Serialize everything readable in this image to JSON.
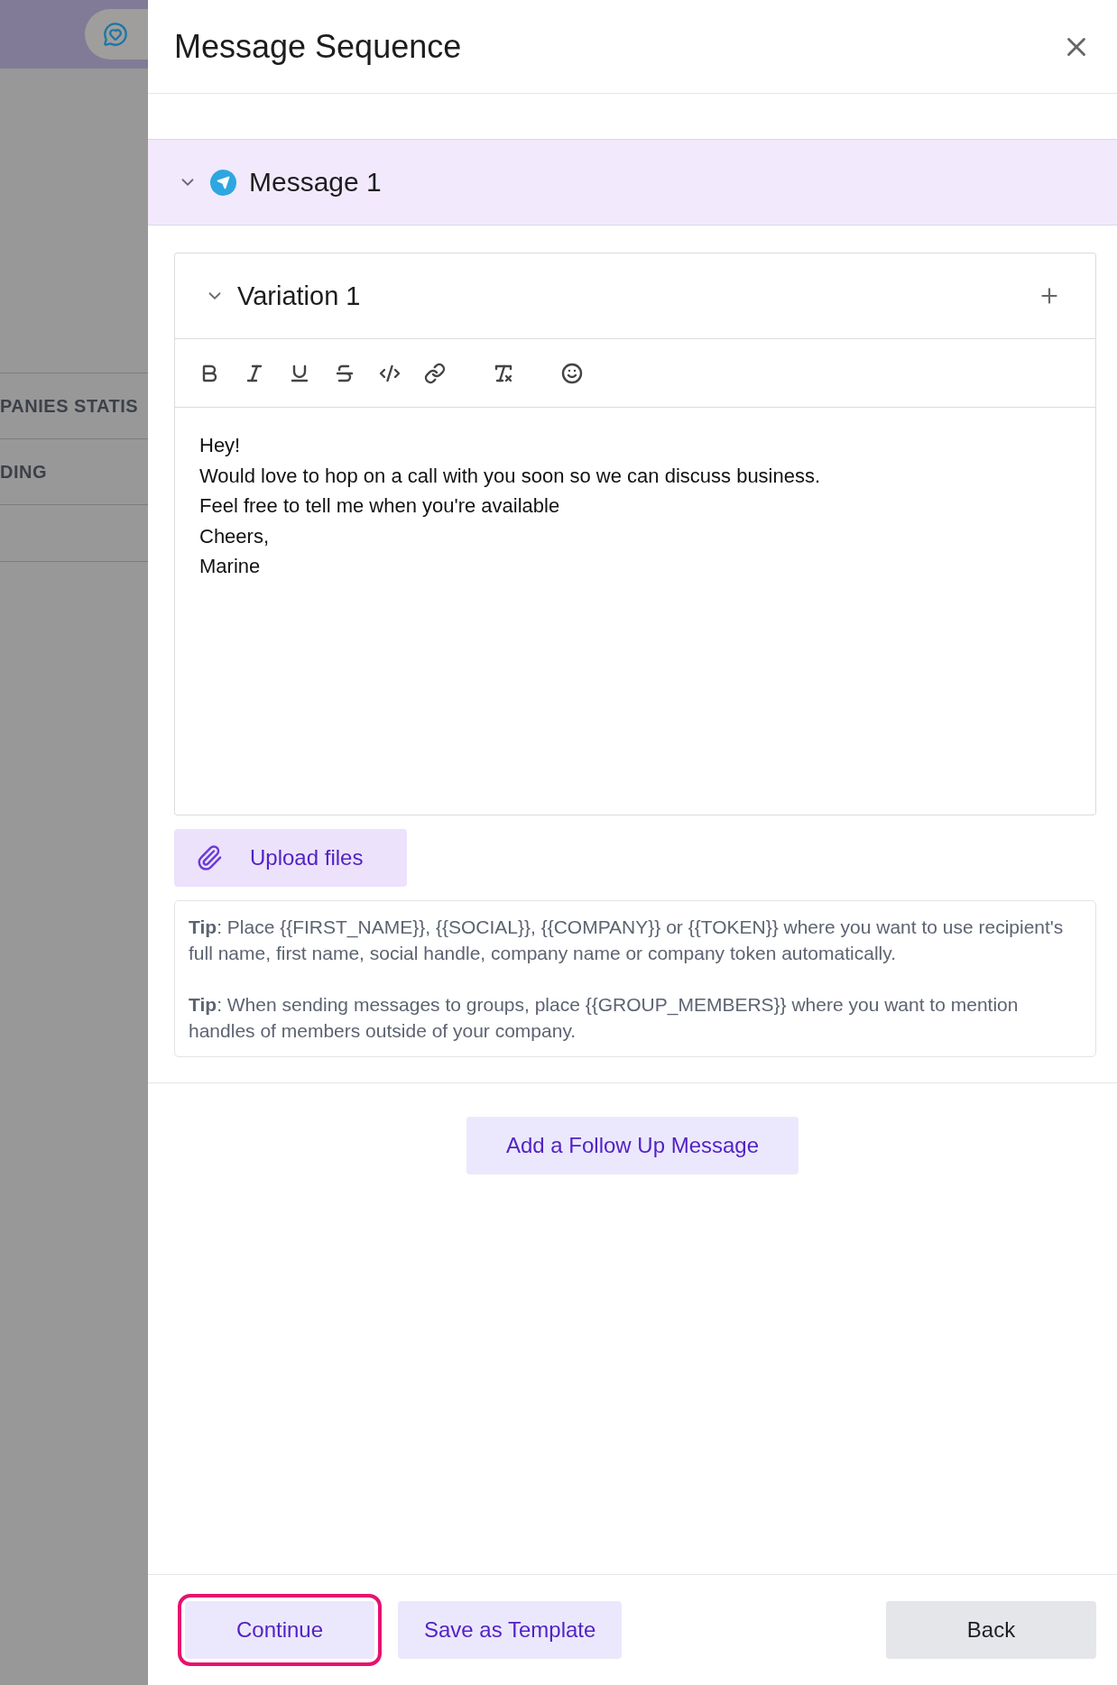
{
  "background": {
    "items": [
      {
        "label": "PANIES STATIS"
      },
      {
        "label": "DING"
      }
    ]
  },
  "dialog": {
    "title": "Message Sequence"
  },
  "messages": [
    {
      "title": "Message 1",
      "expanded": true,
      "variations": [
        {
          "title": "Variation 1",
          "expanded": true,
          "body": "Hey!\nWould love to hop on a call with you soon so we can discuss business.\nFeel free to tell me when you're available\nCheers,\nMarine"
        }
      ]
    }
  ],
  "upload_button": "Upload files",
  "tips": [
    "**Tip**: Place {{FIRST_NAME}}, {{SOCIAL}}, {{COMPANY}} or {{TOKEN}} where you want to use recipient's full name, first name, social handle, company name or company token automatically.",
    "**Tip**: When sending messages to groups, place {{GROUP_MEMBERS}} where you want to mention handles of members outside of your company."
  ],
  "follow_up_button": "Add a Follow Up Message",
  "footer": {
    "buttons": [
      {
        "label": "Continue",
        "kind": "primary",
        "highlighted": true
      },
      {
        "label": "Save as Template",
        "kind": "primary",
        "highlighted": false
      },
      {
        "label": "Back",
        "kind": "secondary",
        "highlighted": false
      }
    ]
  }
}
